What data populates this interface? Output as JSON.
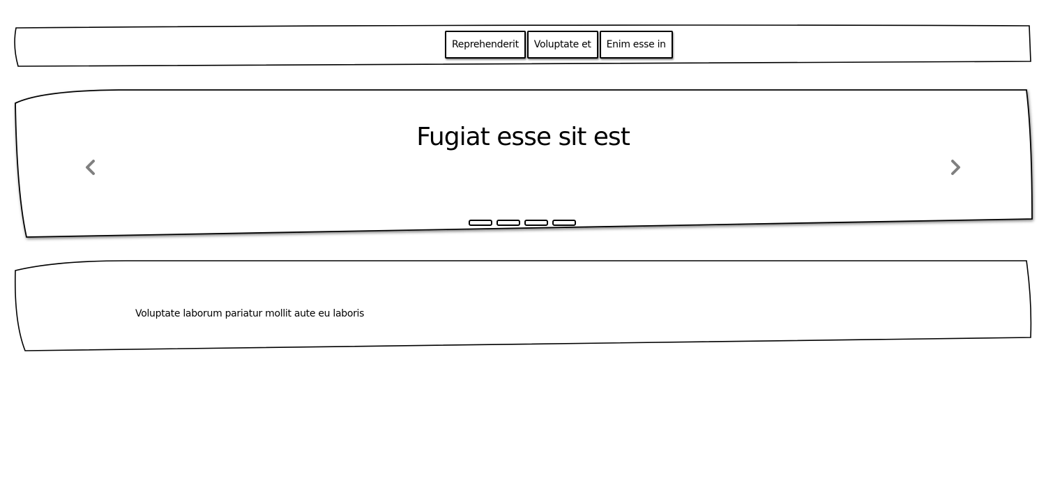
{
  "nav": {
    "items": [
      {
        "label": "Reprehenderit"
      },
      {
        "label": "Voluptate et"
      },
      {
        "label": "Enim esse in"
      }
    ]
  },
  "carousel": {
    "title": "Fugiat esse sit est",
    "indicator_count": 4,
    "prev_icon": "chevron-left-icon",
    "next_icon": "chevron-right-icon",
    "arrow_color": "#808080"
  },
  "content": {
    "text": "Voluptate laborum pariatur mollit aute eu laboris"
  }
}
